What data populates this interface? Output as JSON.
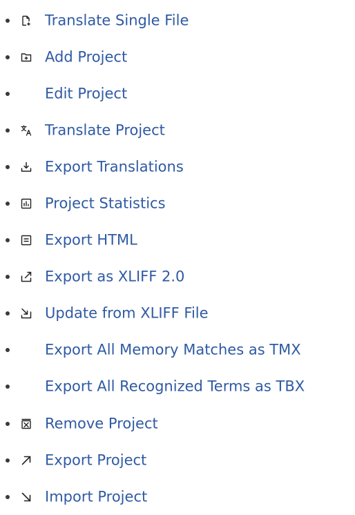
{
  "menu": {
    "items": [
      {
        "label": "Translate Single File",
        "icon": "file-plus-icon"
      },
      {
        "label": "Add Project",
        "icon": "folder-plus-icon"
      },
      {
        "label": "Edit Project",
        "icon": ""
      },
      {
        "label": "Translate Project",
        "icon": "translate-icon"
      },
      {
        "label": "Export Translations",
        "icon": "download-icon"
      },
      {
        "label": "Project Statistics",
        "icon": "bar-chart-icon"
      },
      {
        "label": "Export HTML",
        "icon": "document-icon"
      },
      {
        "label": "Export as XLIFF 2.0",
        "icon": "export-arrow-icon"
      },
      {
        "label": "Update from XLIFF File",
        "icon": "import-arrow-icon"
      },
      {
        "label": "Export All Memory Matches as TMX",
        "icon": ""
      },
      {
        "label": "Export All Recognized Terms as TBX",
        "icon": ""
      },
      {
        "label": "Remove Project",
        "icon": "remove-box-icon"
      },
      {
        "label": "Export Project",
        "icon": "arrow-up-right-icon"
      },
      {
        "label": "Import Project",
        "icon": "arrow-down-right-icon"
      }
    ]
  },
  "colors": {
    "link": "#2f5aa3",
    "bullet": "#3a3a3a",
    "icon": "#222222"
  }
}
